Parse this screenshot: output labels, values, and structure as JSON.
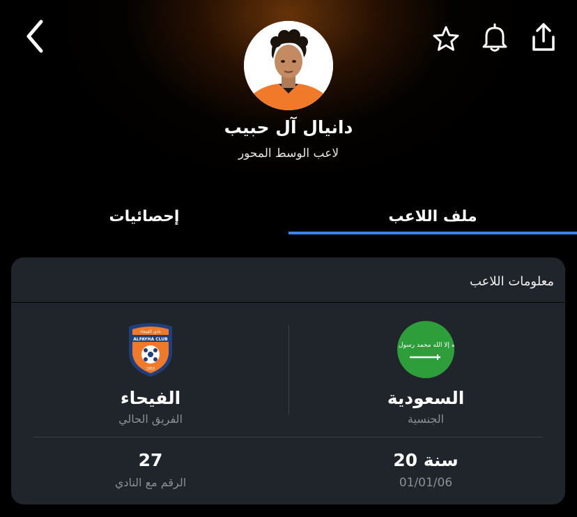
{
  "header": {
    "back_icon": "chevron-left-icon",
    "favorite_icon": "star-icon",
    "notify_icon": "bell-icon",
    "share_icon": "share-icon"
  },
  "player": {
    "name": "دانيال آل حبيب",
    "position": "لاعب الوسط المحور"
  },
  "tabs": [
    {
      "label": "ملف اللاعب",
      "active": true
    },
    {
      "label": "إحصائيات",
      "active": false
    }
  ],
  "info_card": {
    "title": "معلومات اللاعب",
    "nationality": {
      "value": "السعودية",
      "label": "الجنسية",
      "flag_text": "لا إله إلا الله محمد رسول الله"
    },
    "team": {
      "value": "الفيحاء",
      "label": "الفريق الحالي",
      "crest_top": "نادي الفيحاء",
      "crest_band": "ALFAYHA CLUB",
      "crest_year": "1953"
    },
    "age": {
      "value": "20 سنة",
      "label": "01/01/06"
    },
    "number": {
      "value": "27",
      "label": "الرقم مع النادي"
    }
  },
  "colors": {
    "accent": "#3b82f6",
    "card_bg": "#1f252b",
    "flag_green": "#2e9e3a",
    "crest_orange": "#f07a2a",
    "crest_navy": "#1f3f7a"
  }
}
